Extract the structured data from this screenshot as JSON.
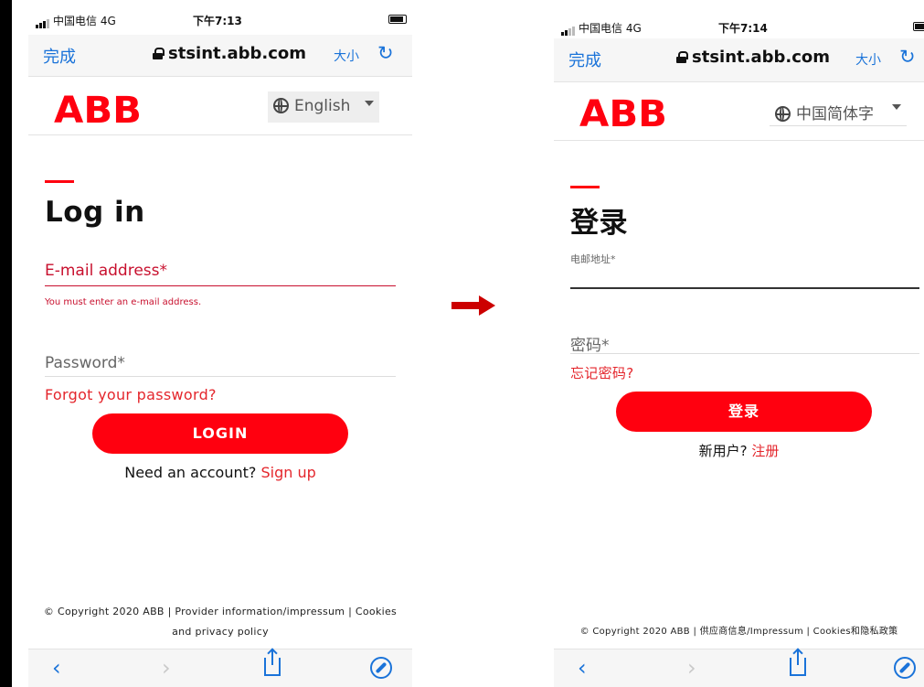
{
  "left": {
    "status": {
      "carrier": "中国电信 4G",
      "time": "下午7:13"
    },
    "browser": {
      "done": "完成",
      "url": "stsint.abb.com",
      "text_size": "大小",
      "reload": "↻"
    },
    "logo_text": "ABB",
    "language": "English",
    "title": "Log in",
    "email": {
      "label": "E-mail address*",
      "error": "You must enter an e-mail address."
    },
    "password": {
      "label": "Password*"
    },
    "forgot": "Forgot your password?",
    "login_button": "LOGIN",
    "signup": {
      "prompt": "Need an account?",
      "link": "Sign up"
    },
    "footer": {
      "line1": "© Copyright 2020 ABB | Provider information/impressum | Cookies",
      "line2": "and privacy policy"
    },
    "toolbar": {
      "back": "‹",
      "forward": "›"
    }
  },
  "right": {
    "status": {
      "carrier": "中国电信 4G",
      "time": "下午7:14"
    },
    "browser": {
      "done": "完成",
      "url": "stsint.abb.com",
      "text_size": "大小",
      "reload": "↻"
    },
    "logo_text": "ABB",
    "language": "中国简体字",
    "title": "登录",
    "email": {
      "label": "电邮地址*"
    },
    "password": {
      "label": "密码*"
    },
    "forgot": "忘记密码?",
    "login_button": "登录",
    "signup": {
      "prompt": "新用户?",
      "link": "注册"
    },
    "footer": {
      "line1": "© Copyright 2020 ABB | 供应商信息/Impressum | Cookies和隐私政策"
    },
    "toolbar": {
      "back": "‹",
      "forward": "›"
    }
  },
  "colors": {
    "abb_red": "#ff000f",
    "ios_blue": "#1a73d9",
    "error_red": "#c8102e",
    "arrow_red": "#cc0000"
  }
}
